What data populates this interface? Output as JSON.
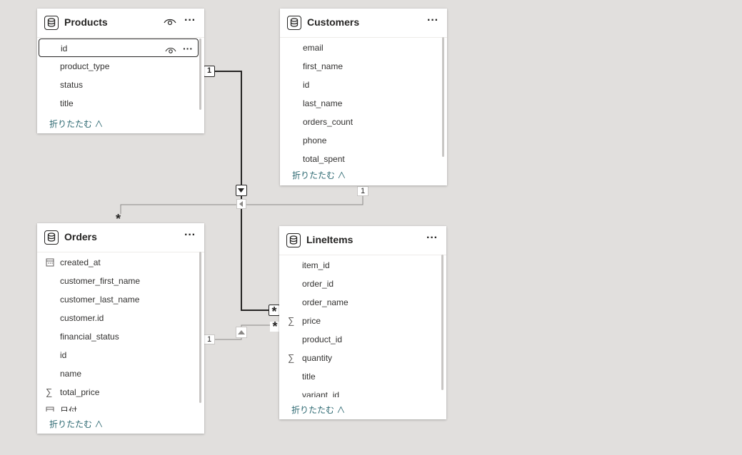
{
  "colors": {
    "canvas": "#e1dfdd",
    "card": "#ffffff",
    "line_active": "#252423",
    "line_inactive": "#8a8886",
    "collapse_link": "#2b6770"
  },
  "tables": {
    "products": {
      "title": "Products",
      "icon": "table-icon",
      "fields": [
        {
          "name": "id"
        },
        {
          "name": "product_type"
        },
        {
          "name": "status"
        },
        {
          "name": "title"
        }
      ],
      "collapse_label": "折りたたむ ∧"
    },
    "customers": {
      "title": "Customers",
      "icon": "table-icon",
      "fields": [
        {
          "name": "email"
        },
        {
          "name": "first_name"
        },
        {
          "name": "id"
        },
        {
          "name": "last_name"
        },
        {
          "name": "orders_count"
        },
        {
          "name": "phone"
        },
        {
          "name": "total_spent"
        }
      ],
      "collapse_label": "折りたたむ ∧"
    },
    "orders": {
      "title": "Orders",
      "icon": "table-icon",
      "fields": [
        {
          "name": "created_at",
          "icon": "calendar-icon"
        },
        {
          "name": "customer_first_name"
        },
        {
          "name": "customer_last_name"
        },
        {
          "name": "customer.id"
        },
        {
          "name": "financial_status"
        },
        {
          "name": "id"
        },
        {
          "name": "name"
        },
        {
          "name": "total_price",
          "icon": "sigma-icon"
        },
        {
          "name": "日付",
          "icon": "calendar-icon"
        }
      ],
      "collapse_label": "折りたたむ ∧"
    },
    "lineitems": {
      "title": "LineItems",
      "icon": "table-icon",
      "fields": [
        {
          "name": "item_id"
        },
        {
          "name": "order_id"
        },
        {
          "name": "order_name"
        },
        {
          "name": "price",
          "icon": "sigma-icon"
        },
        {
          "name": "product_id"
        },
        {
          "name": "quantity",
          "icon": "sigma-icon"
        },
        {
          "name": "title"
        },
        {
          "name": "variant_id"
        }
      ],
      "collapse_label": "折りたたむ ∧"
    }
  },
  "relationships": {
    "products_lineitems": {
      "from": "Products",
      "to": "LineItems",
      "from_card": "1",
      "to_card": "*",
      "active": true
    },
    "customers_orders": {
      "from": "Customers",
      "to": "Orders",
      "from_card": "1",
      "to_card": "*",
      "active": false
    },
    "orders_lineitems": {
      "from": "Orders",
      "to": "LineItems",
      "from_card": "1",
      "to_card": "*",
      "active": false
    }
  }
}
